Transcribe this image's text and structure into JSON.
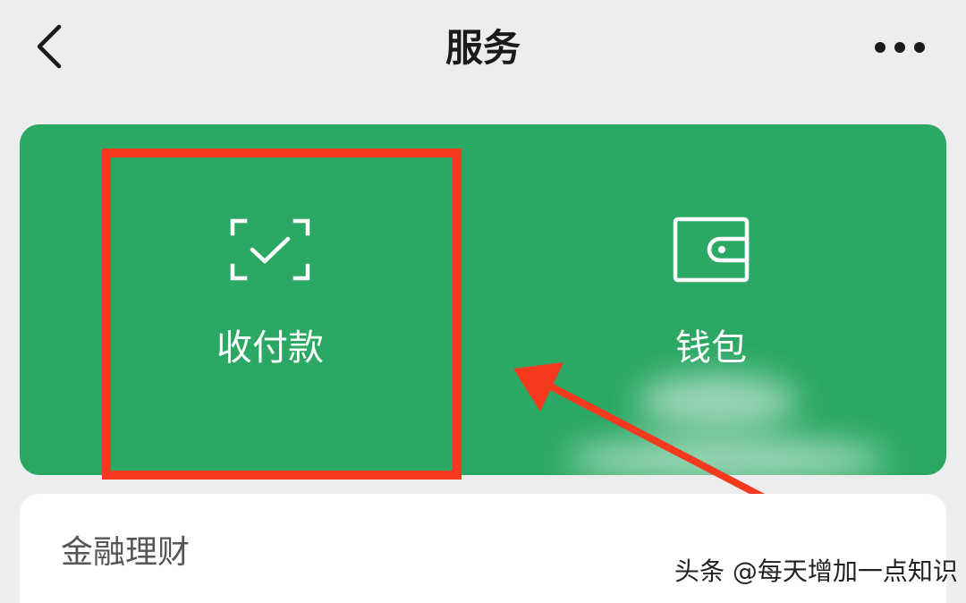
{
  "header": {
    "title": "服务",
    "back_icon": "chevron-left-icon",
    "more_icon": "more-dots-icon"
  },
  "services": {
    "items": [
      {
        "label": "收付款",
        "icon": "scan-check-icon"
      },
      {
        "label": "钱包",
        "icon": "wallet-icon"
      }
    ]
  },
  "finance": {
    "title": "金融理财"
  },
  "watermark": {
    "text": "头条 @每天增加一点知识"
  },
  "colors": {
    "background": "#ededed",
    "card_green": "#2ba864",
    "highlight_red": "#f53a1f",
    "text_dark": "#1a1a1a",
    "text_white": "#ffffff"
  }
}
